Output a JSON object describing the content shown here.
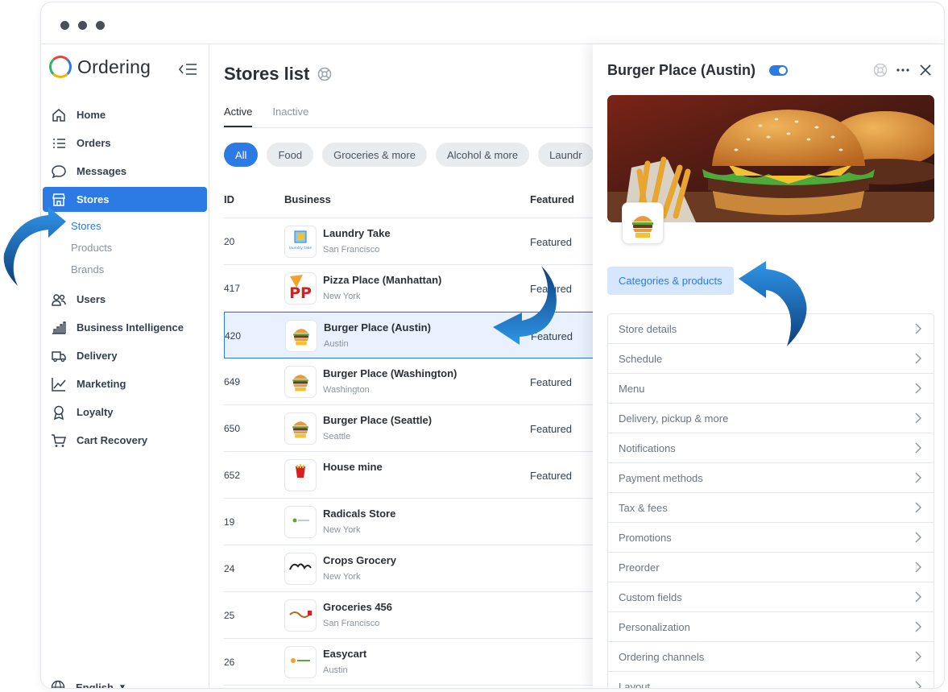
{
  "app": {
    "brand": "Ordering",
    "language": "English"
  },
  "sidebar": {
    "items": [
      {
        "label": "Home",
        "icon": "home-icon"
      },
      {
        "label": "Orders",
        "icon": "orders-list-icon"
      },
      {
        "label": "Messages",
        "icon": "chat-bubble-icon"
      },
      {
        "label": "Stores",
        "icon": "storefront-icon",
        "active": true
      },
      {
        "label": "Users",
        "icon": "users-icon"
      },
      {
        "label": "Business Intelligence",
        "icon": "bar-chart-icon"
      },
      {
        "label": "Delivery",
        "icon": "truck-icon"
      },
      {
        "label": "Marketing",
        "icon": "line-chart-icon"
      },
      {
        "label": "Loyalty",
        "icon": "award-icon"
      },
      {
        "label": "Cart Recovery",
        "icon": "cart-icon"
      }
    ],
    "subitems": [
      "Stores",
      "Products",
      "Brands"
    ]
  },
  "main": {
    "title": "Stores list",
    "tabs": [
      "Active",
      "Inactive"
    ],
    "chips": [
      "All",
      "Food",
      "Groceries & more",
      "Alcohol & more",
      "Laundr"
    ],
    "columns": {
      "id": "ID",
      "business": "Business",
      "featured": "Featured"
    },
    "rows": [
      {
        "id": "20",
        "name": "Laundry Take",
        "city": "San Francisco",
        "featured": "Featured",
        "logo": "laundry"
      },
      {
        "id": "417",
        "name": "Pizza Place (Manhattan)",
        "city": "New York",
        "featured": "Featured",
        "logo": "pizza"
      },
      {
        "id": "420",
        "name": "Burger Place (Austin)",
        "city": "Austin",
        "featured": "Featured",
        "logo": "burger",
        "selected": true
      },
      {
        "id": "649",
        "name": "Burger Place (Washington)",
        "city": "Washington",
        "featured": "Featured",
        "logo": "burger"
      },
      {
        "id": "650",
        "name": "Burger Place (Seattle)",
        "city": "Seattle",
        "featured": "Featured",
        "logo": "burger"
      },
      {
        "id": "652",
        "name": "House mine",
        "city": "",
        "featured": "Featured",
        "logo": "mcd"
      },
      {
        "id": "19",
        "name": "Radicals Store",
        "city": "New York",
        "featured": "",
        "logo": "radicals"
      },
      {
        "id": "24",
        "name": "Crops Grocery",
        "city": "New York",
        "featured": "",
        "logo": "crops"
      },
      {
        "id": "25",
        "name": "Groceries 456",
        "city": "San Francisco",
        "featured": "",
        "logo": "groceries"
      },
      {
        "id": "26",
        "name": "Easycart",
        "city": "Austin",
        "featured": "",
        "logo": "easycart"
      }
    ]
  },
  "panel": {
    "title": "Burger Place (Austin)",
    "category_button": "Categories & products",
    "menu": [
      "Store details",
      "Schedule",
      "Menu",
      "Delivery, pickup & more",
      "Notifications",
      "Payment methods",
      "Tax & fees",
      "Promotions",
      "Preorder",
      "Custom fields",
      "Personalization",
      "Ordering channels",
      "Layout"
    ]
  },
  "colors": {
    "accent": "#2c7be5",
    "accent_light": "#d6e6fc",
    "text": "#344050",
    "muted": "#8a93a0"
  }
}
